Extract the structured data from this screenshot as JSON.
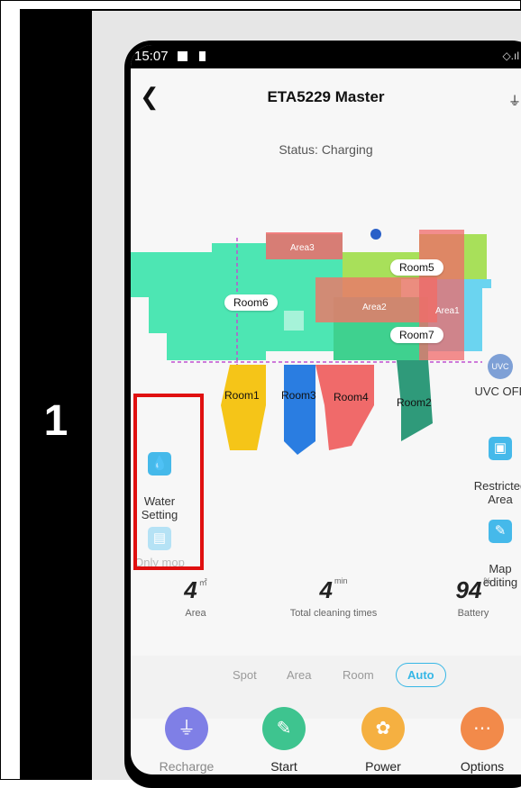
{
  "step_number": "1",
  "statusbar": {
    "time": "15:07"
  },
  "header": {
    "title": "ETA5229 Master",
    "status": "Status: Charging"
  },
  "map": {
    "rooms": [
      "Room1",
      "Room2",
      "Room3",
      "Room4",
      "Room5",
      "Room6",
      "Room7"
    ],
    "zones": [
      "Area1",
      "Area2",
      "Area3"
    ]
  },
  "left_controls": {
    "water_setting": "Water\nSetting",
    "only_mop": "Only mop"
  },
  "right_controls": {
    "uvc_icon": "UVC",
    "uvc_label": "UVC OFF",
    "restricted_label": "Restricted\nArea",
    "map_editing_label": "Map\nediting"
  },
  "stats": [
    {
      "value": "4",
      "unit": "㎡",
      "label": "Area"
    },
    {
      "value": "4",
      "unit": "min",
      "label": "Total cleaning times"
    },
    {
      "value": "94",
      "unit": "%",
      "label": "Battery"
    }
  ],
  "modes": [
    "Spot",
    "Area",
    "Room",
    "Auto"
  ],
  "active_mode": "Auto",
  "actions": [
    {
      "label": "Recharge",
      "color": "#7f7fe6"
    },
    {
      "label": "Start",
      "color": "#3ec48f"
    },
    {
      "label": "Power",
      "color": "#f5b041"
    },
    {
      "label": "Options",
      "color": "#f28a4a"
    }
  ],
  "colors": {
    "accent": "#36b7e6",
    "highlight_box": "#e01010"
  }
}
